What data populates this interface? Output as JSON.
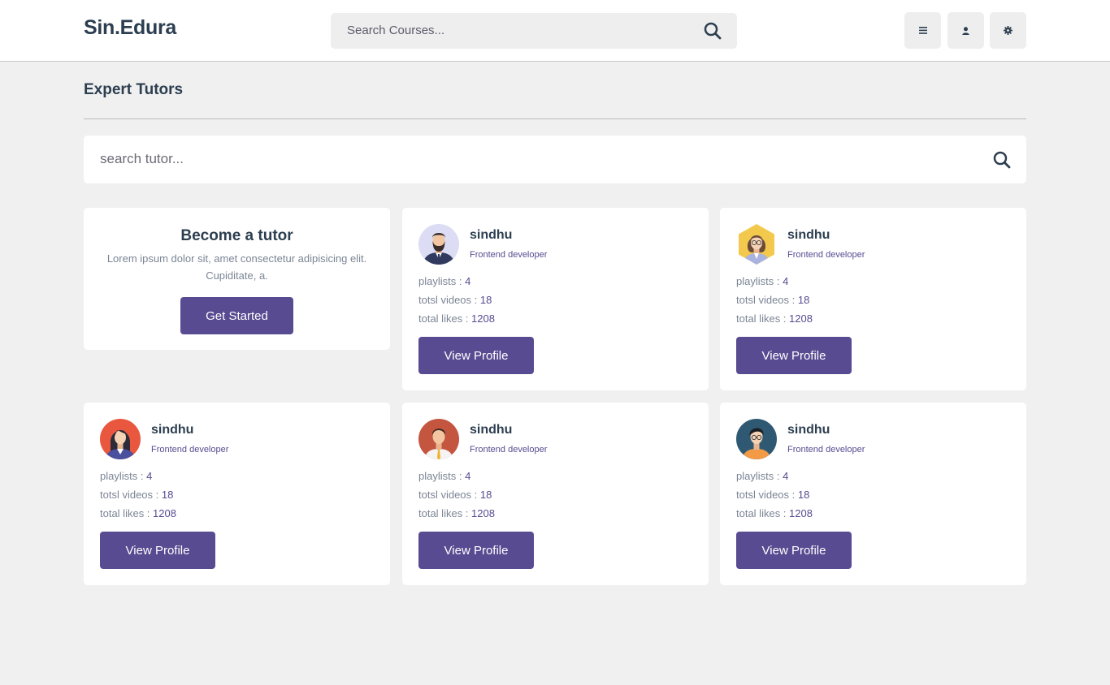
{
  "header": {
    "logo": "Sin.Edura",
    "search_placeholder": "Search Courses...",
    "buttons": [
      "menu-icon",
      "user-icon",
      "settings-icon"
    ]
  },
  "main": {
    "title": "Expert Tutors",
    "search_placeholder": "search tutor..."
  },
  "become": {
    "title": "Become a tutor",
    "text": "Lorem ipsum dolor sit, amet consectetur adipisicing elit. Cupiditate, a.",
    "button": "Get Started"
  },
  "labels": {
    "playlists": "playlists : ",
    "videos": "totsl videos : ",
    "likes": "total likes : "
  },
  "tutors": [
    {
      "name": "sindhu",
      "role": "Frontend developer",
      "playlists": "4",
      "videos": "18",
      "likes": "1208",
      "button": "View Profile",
      "avatar": "bearded-man-avatar-icon"
    },
    {
      "name": "sindhu",
      "role": "Frontend developer",
      "playlists": "4",
      "videos": "18",
      "likes": "1208",
      "button": "View Profile",
      "avatar": "woman-glasses-avatar-icon"
    },
    {
      "name": "sindhu",
      "role": "Frontend developer",
      "playlists": "4",
      "videos": "18",
      "likes": "1208",
      "button": "View Profile",
      "avatar": "woman-avatar-icon"
    },
    {
      "name": "sindhu",
      "role": "Frontend developer",
      "playlists": "4",
      "videos": "18",
      "likes": "1208",
      "button": "View Profile",
      "avatar": "man-tie-avatar-icon"
    },
    {
      "name": "sindhu",
      "role": "Frontend developer",
      "playlists": "4",
      "videos": "18",
      "likes": "1208",
      "button": "View Profile",
      "avatar": "man-glasses-avatar-icon"
    }
  ],
  "colors": {
    "accent": "#584b91",
    "text": "#2c3e50",
    "muted": "#7b8595",
    "background": "#f0f0f0"
  }
}
